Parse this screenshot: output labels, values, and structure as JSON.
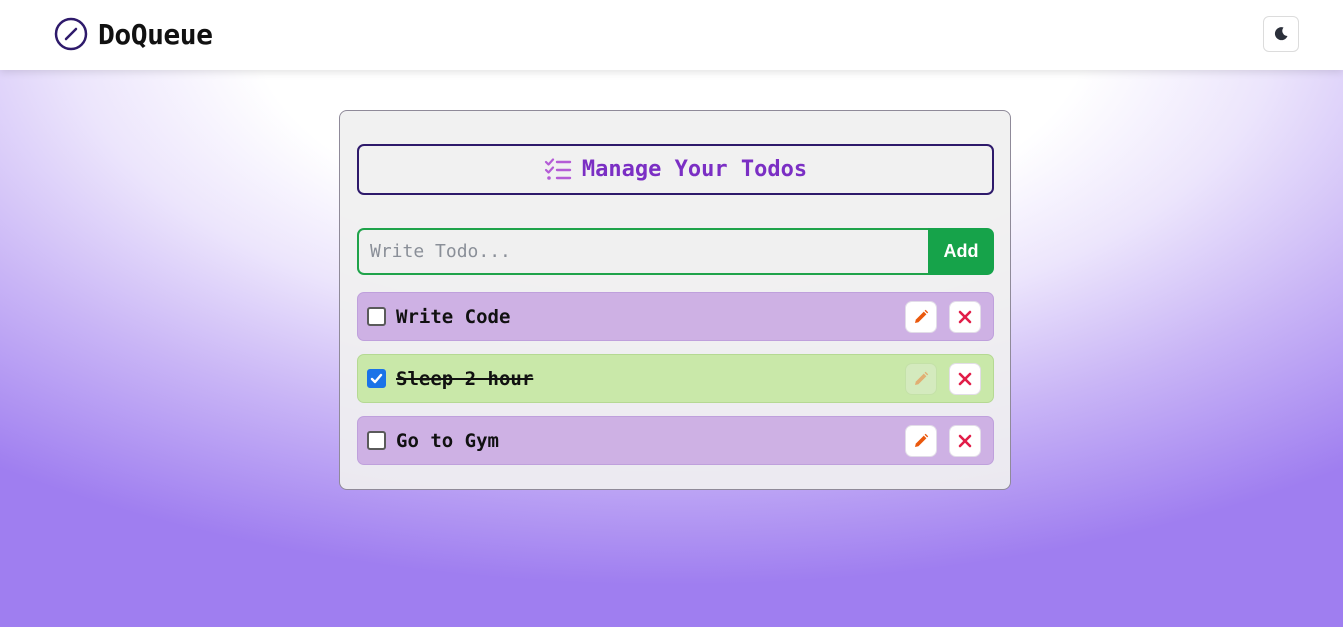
{
  "header": {
    "brand_name": "DoQueue",
    "brand_icon": "clock-check-icon",
    "theme_toggle_icon": "moon-icon"
  },
  "main": {
    "heading": "Manage Your Todos",
    "heading_icon": "checklist-icon",
    "input": {
      "placeholder": "Write Todo...",
      "value": ""
    },
    "add_label": "Add",
    "todos": [
      {
        "text": "Write Code",
        "completed": false
      },
      {
        "text": "Sleep 2 hour",
        "completed": true
      },
      {
        "text": "Go to Gym",
        "completed": false
      }
    ]
  },
  "colors": {
    "accent_purple": "#7b2fc4",
    "add_green": "#16a34a",
    "pending_bg": "#ceb1e4",
    "done_bg": "#c9e8a9",
    "delete_red": "#e11d48",
    "edit_orange": "#ea580c"
  }
}
